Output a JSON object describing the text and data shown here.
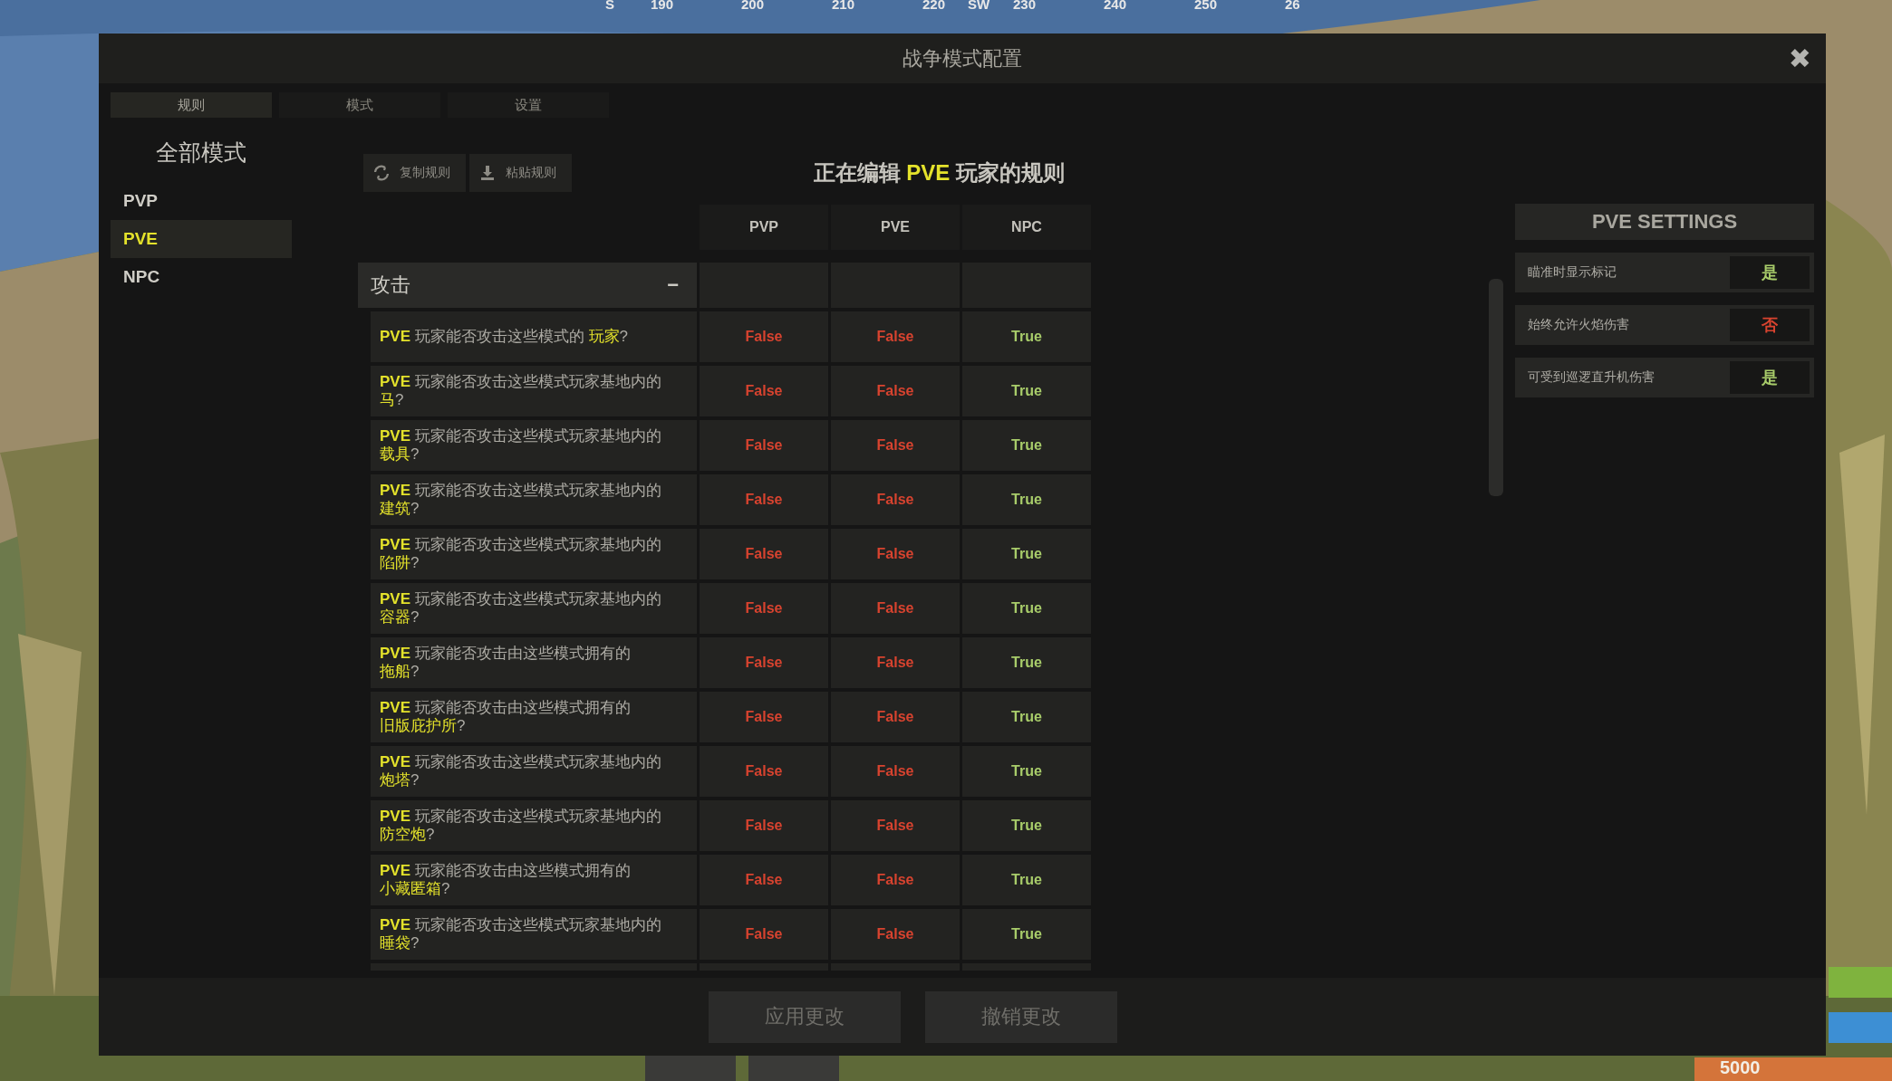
{
  "compass": [
    "S",
    "190",
    "200",
    "210",
    "220",
    "SW",
    "230",
    "240",
    "250",
    "26"
  ],
  "window": {
    "title": "战争模式配置",
    "close": "✖"
  },
  "tabs": [
    {
      "label": "规则",
      "selected": true
    },
    {
      "label": "模式",
      "selected": false
    },
    {
      "label": "设置",
      "selected": false
    }
  ],
  "sidebar": {
    "title": "全部模式",
    "items": [
      {
        "label": "PVP",
        "selected": false
      },
      {
        "label": "PVE",
        "selected": true
      },
      {
        "label": "NPC",
        "selected": false
      }
    ]
  },
  "toolbar": [
    {
      "kind": "copy",
      "label": "复制规则"
    },
    {
      "kind": "paste",
      "label": "粘贴规则"
    }
  ],
  "heading": {
    "before": "正在编辑 ",
    "highlight": "PVE",
    "after": " 玩家的规则"
  },
  "table": {
    "columns": [
      "PVP",
      "PVE",
      "NPC"
    ],
    "section": {
      "title": "攻击",
      "toggle": "−"
    },
    "rows": [
      {
        "subject": "PVE",
        "question": "玩家能否攻击这些模式的 ",
        "target": "玩家",
        "end": "?",
        "cells": [
          {
            "text": "False",
            "on": false
          },
          {
            "text": "False",
            "on": false
          },
          {
            "text": "True",
            "on": true
          }
        ]
      },
      {
        "subject": "PVE",
        "question": "玩家能否攻击这些模式玩家基地内的",
        "target": "马",
        "end": "?",
        "cells": [
          {
            "text": "False",
            "on": false
          },
          {
            "text": "False",
            "on": false
          },
          {
            "text": "True",
            "on": true
          }
        ]
      },
      {
        "subject": "PVE",
        "question": "玩家能否攻击这些模式玩家基地内的",
        "target": "载具",
        "end": "?",
        "cells": [
          {
            "text": "False",
            "on": false
          },
          {
            "text": "False",
            "on": false
          },
          {
            "text": "True",
            "on": true
          }
        ]
      },
      {
        "subject": "PVE",
        "question": "玩家能否攻击这些模式玩家基地内的",
        "target": "建筑",
        "end": "?",
        "cells": [
          {
            "text": "False",
            "on": false
          },
          {
            "text": "False",
            "on": false
          },
          {
            "text": "True",
            "on": true
          }
        ]
      },
      {
        "subject": "PVE",
        "question": "玩家能否攻击这些模式玩家基地内的",
        "target": "陷阱",
        "end": "?",
        "cells": [
          {
            "text": "False",
            "on": false
          },
          {
            "text": "False",
            "on": false
          },
          {
            "text": "True",
            "on": true
          }
        ]
      },
      {
        "subject": "PVE",
        "question": "玩家能否攻击这些模式玩家基地内的",
        "target": "容器",
        "end": "?",
        "cells": [
          {
            "text": "False",
            "on": false
          },
          {
            "text": "False",
            "on": false
          },
          {
            "text": "True",
            "on": true
          }
        ]
      },
      {
        "subject": "PVE",
        "question": "玩家能否攻击由这些模式拥有的",
        "target": "拖船",
        "end": "?",
        "cells": [
          {
            "text": "False",
            "on": false
          },
          {
            "text": "False",
            "on": false
          },
          {
            "text": "True",
            "on": true
          }
        ]
      },
      {
        "subject": "PVE",
        "question": "玩家能否攻击由这些模式拥有的",
        "target": "旧版庇护所",
        "end": "?",
        "cells": [
          {
            "text": "False",
            "on": false
          },
          {
            "text": "False",
            "on": false
          },
          {
            "text": "True",
            "on": true
          }
        ]
      },
      {
        "subject": "PVE",
        "question": "玩家能否攻击这些模式玩家基地内的",
        "target": "炮塔",
        "end": "?",
        "cells": [
          {
            "text": "False",
            "on": false
          },
          {
            "text": "False",
            "on": false
          },
          {
            "text": "True",
            "on": true
          }
        ]
      },
      {
        "subject": "PVE",
        "question": "玩家能否攻击这些模式玩家基地内的",
        "target": "防空炮",
        "end": "?",
        "cells": [
          {
            "text": "False",
            "on": false
          },
          {
            "text": "False",
            "on": false
          },
          {
            "text": "True",
            "on": true
          }
        ]
      },
      {
        "subject": "PVE",
        "question": "玩家能否攻击由这些模式拥有的",
        "target": "小藏匿箱",
        "end": "?",
        "cells": [
          {
            "text": "False",
            "on": false
          },
          {
            "text": "False",
            "on": false
          },
          {
            "text": "True",
            "on": true
          }
        ]
      },
      {
        "subject": "PVE",
        "question": "玩家能否攻击这些模式玩家基地内的",
        "target": "睡袋",
        "end": "?",
        "cells": [
          {
            "text": "False",
            "on": false
          },
          {
            "text": "False",
            "on": false
          },
          {
            "text": "True",
            "on": true
          }
        ]
      }
    ]
  },
  "settings": {
    "title": "PVE SETTINGS",
    "items": [
      {
        "label": "瞄准时显示标记",
        "value": "是",
        "on": true
      },
      {
        "label": "始终允许火焰伤害",
        "value": "否",
        "on": false
      },
      {
        "label": "可受到巡逻直升机伤害",
        "value": "是",
        "on": true
      }
    ]
  },
  "footer": {
    "buttons": [
      "应用更改",
      "撤销更改"
    ]
  },
  "hud": {
    "amount": "5000"
  }
}
